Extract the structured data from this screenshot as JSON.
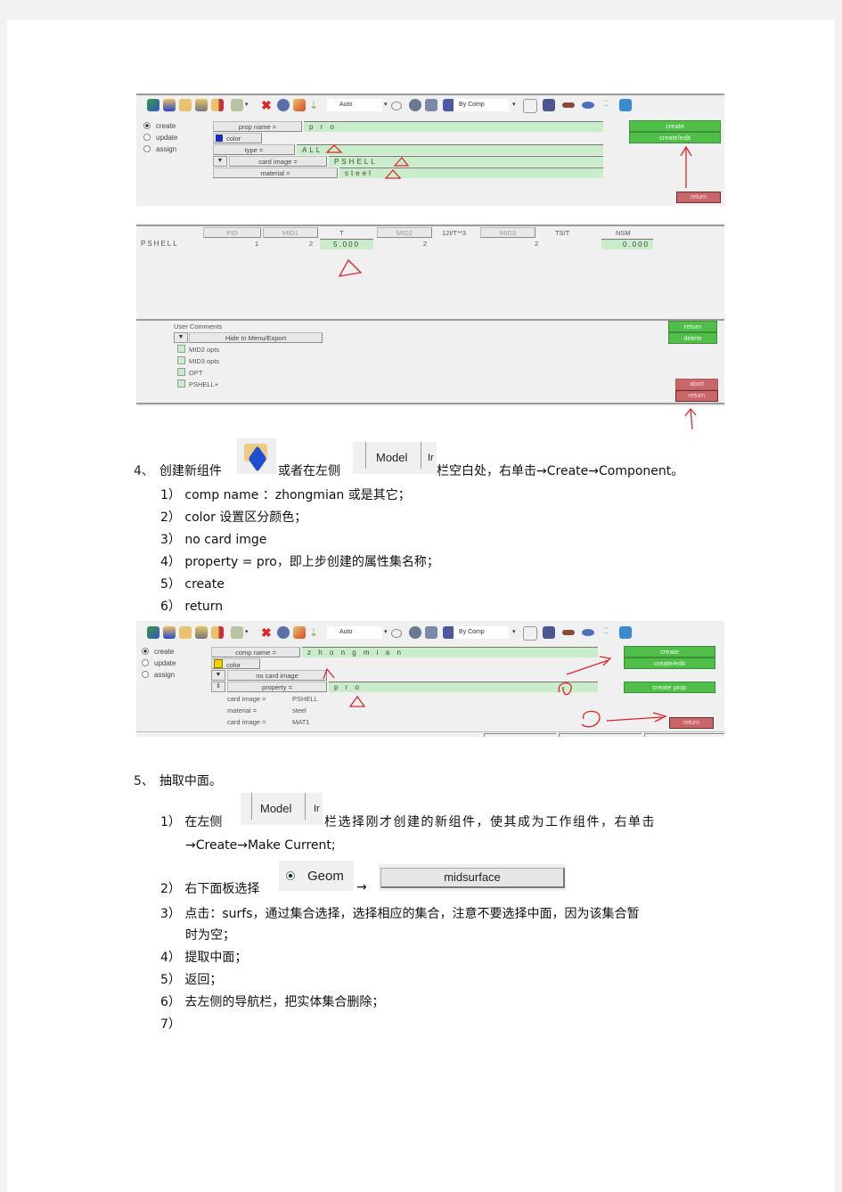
{
  "document": {
    "panel1": {
      "toolbar": {
        "display_mode": "Auto",
        "color_mode": "By Comp"
      },
      "radios": [
        {
          "label": "create",
          "selected": true
        },
        {
          "label": "update",
          "selected": false
        },
        {
          "label": "assign",
          "selected": false
        }
      ],
      "rows": {
        "prop_name_label": "prop name =",
        "prop_name_value": "p r o",
        "color_label": "color",
        "color_swatch": "#1a2fbf",
        "type_label": "type =",
        "type_value": "ALL",
        "card_image_label": "card image =",
        "card_image_value": "PSHELL",
        "material_label": "material =",
        "material_value": "steel"
      },
      "buttons": {
        "create": "create",
        "create_edit": "create/edit",
        "return": "return"
      }
    },
    "panel2": {
      "headers": [
        "PID",
        "MID1",
        "T",
        "MID2",
        "12I/T**3",
        "MID3",
        "TS/T",
        "NSM"
      ],
      "row_label": "PSHELL",
      "values": [
        "1",
        "2",
        "5.000",
        "2",
        "",
        "2",
        "",
        "0.000"
      ],
      "user_comments_label": "User Comments",
      "comments_dropdown": "Hide In Menu/Export",
      "checkboxes": [
        "MID2 opts",
        "MID3 opts",
        "OPT",
        "PSHELL+"
      ],
      "buttons": {
        "return_top": "return",
        "delete": "delete",
        "abort": "abort",
        "return": "return"
      }
    },
    "step4": {
      "heading_num": "4、",
      "heading_text_a": "创建新组件",
      "heading_text_b": "或者在左侧",
      "heading_text_c": "栏空白处，右单击→Create→Component。",
      "model_tab": "Model",
      "model_tab_next": "Ir",
      "items": [
        {
          "num": "1）",
          "text": "comp  name   ：zhongmian   或是其它；"
        },
        {
          "num": "2）",
          "text": "color   设置区分颜色；"
        },
        {
          "num": "3）",
          "text": "no  card  imge"
        },
        {
          "num": "4）",
          "text": "property  =  pro，即上步创建的属性集名称；"
        },
        {
          "num": "5）",
          "text": "create"
        },
        {
          "num": "6）",
          "text": "return"
        }
      ]
    },
    "panel3": {
      "toolbar": {
        "display_mode": "Auto",
        "color_mode": "By Comp"
      },
      "radios": [
        {
          "label": "create",
          "selected": true
        },
        {
          "label": "update",
          "selected": false
        },
        {
          "label": "assign",
          "selected": false
        }
      ],
      "rows": {
        "comp_name_label": "comp name =",
        "comp_name_value": "z h o n g m i a n",
        "color_label": "color",
        "color_swatch": "#f2d200",
        "no_card_image_label": "no card image",
        "property_label": "property =",
        "property_value": "p r o"
      },
      "info": [
        {
          "label": "card image =",
          "value": "PSHELL"
        },
        {
          "label": "material =",
          "value": "steel"
        },
        {
          "label": "card image =",
          "value": "MAT1"
        }
      ],
      "buttons": {
        "create": "create",
        "create_edit": "create/edit",
        "create_prop": "create prop",
        "return": "return"
      }
    },
    "step5": {
      "heading_num": "5、",
      "heading_text": "抽取中面。",
      "item1_num": "1）",
      "item1_a": "在左侧",
      "item1_b": "栏选择刚才创建的新组件，使其成为工作组件，右单击",
      "item1_c": "→Create→Make  Current;",
      "model_tab": "Model",
      "model_tab_next": "Ir",
      "item2_num": "2）",
      "item2_a": "右下面板选择",
      "geom_label": "Geom",
      "arrow": "→",
      "midsurface_label": "midsurface",
      "items": [
        {
          "num": "3）",
          "text": "点击：surfs，通过集合选择，选择相应的集合，注意不要选择中面，因为该集合暂"
        },
        {
          "num": "",
          "text": "时为空；"
        },
        {
          "num": "4）",
          "text": "提取中面；"
        },
        {
          "num": "5）",
          "text": "返回；"
        },
        {
          "num": "6）",
          "text": "去左侧的导航栏，把实体集合删除；"
        },
        {
          "num": "7）",
          "text": ""
        }
      ]
    }
  }
}
